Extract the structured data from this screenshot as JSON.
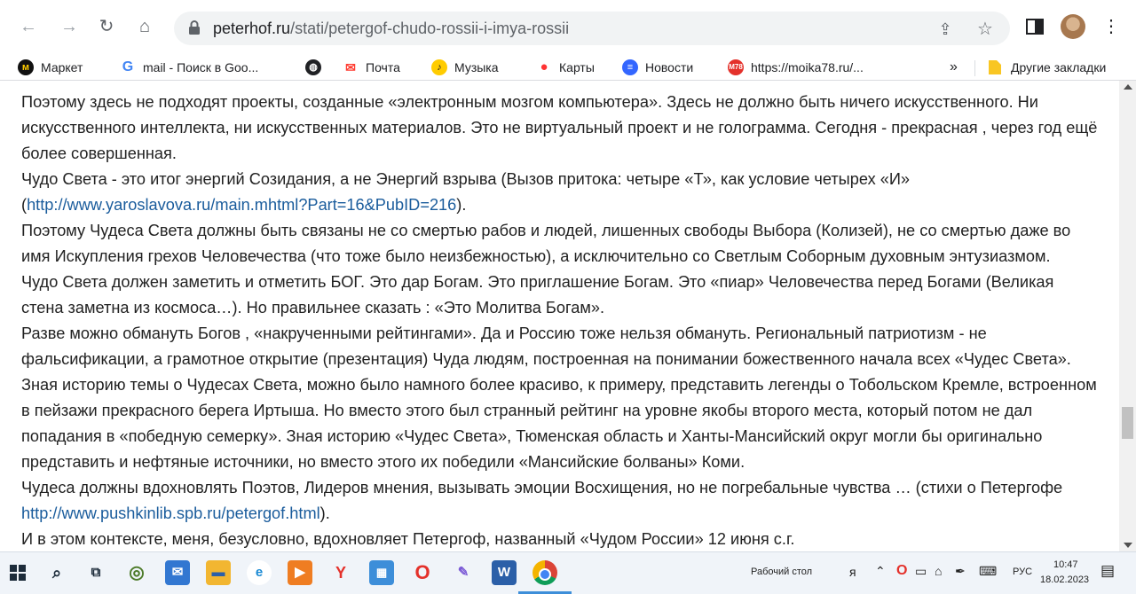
{
  "browser": {
    "url_domain": "peterhof.ru",
    "url_path": "/stati/petergof-chudo-rossii-i-imya-rossii"
  },
  "bookmarks": [
    {
      "label": "Маркет",
      "icon": "yandex-market-icon",
      "color": "#fc3f1d"
    },
    {
      "label": "mail - Поиск в Goo...",
      "icon": "google-icon",
      "color": "#4285f4"
    },
    {
      "label": "",
      "icon": "globe-icon",
      "color": "#202124"
    },
    {
      "label": "Почта",
      "icon": "mail-icon",
      "color": "#ffcc00"
    },
    {
      "label": "Музыка",
      "icon": "music-icon",
      "color": "#ff9900"
    },
    {
      "label": "Карты",
      "icon": "map-pin-icon",
      "color": "#ff3333"
    },
    {
      "label": "Новости",
      "icon": "news-icon",
      "color": "#3366ff"
    },
    {
      "label": "https://moika78.ru/...",
      "icon": "m78-icon",
      "color": "#e4312b"
    }
  ],
  "bookmarks_more": "»",
  "other_bookmarks": "Другие закладки",
  "article": {
    "p1": "Поэтому здесь не подходят проекты, созданные «электронным мозгом компьютера». Здесь не должно быть ничего искусственного. Ни искусственного интеллекта, ни искусственных материалов. Это не виртуальный проект и не голограмма. Сегодня - прекрасная , через год ещё более совершенная.",
    "p2_text": "Чудо Света - это итог энергий Созидания, а не Энергий взрыва (Вызов притока: четыре «Т», как условие четырех «И» (",
    "p2_link": "http://www.yaroslavova.ru/main.mhtml?Part=16&PubID=216",
    "p2_end": ").",
    "p3": "Поэтому Чудеса Света должны быть связаны не со смертью рабов и людей, лишенных свободы Выбора (Колизей), не со смертью даже во имя Искупления грехов Человечества (что тоже было неизбежностью), а исключительно со Светлым Соборным духовным энтузиазмом.",
    "p4": "Чудо Света должен заметить и отметить БОГ. Это дар Богам. Это приглашение Богам. Это «пиар» Человечества перед Богами (Великая стена заметна из космоса…). Но правильнее сказать : «Это Молитва Богам».",
    "p5": "Разве можно обмануть Богов , «накрученными рейтингами». Да и Россию тоже нельзя обмануть. Региональный патриотизм - не фальсификации, а грамотное открытие (презентация) Чуда людям, построенная на понимании божественного начала всех «Чудес Света». Зная историю темы о Чудесах Света, можно было намного более красиво, к примеру, представить легенды о Тобольском Кремле, встроенном в пейзажи прекрасного берега Иртыша. Но вместо этого был странный рейтинг на уровне якобы второго места, который потом не дал попадания в «победную семерку». Зная историю «Чудес Света», Тюменская область и Ханты-Мансийский округ могли бы оригинально представить и нефтяные источники, но вместо этого их победили «Мансийские болваны» Коми.",
    "p6_text": "Чудеса должны вдохновлять Поэтов, Лидеров мнения, вызывать эмоции Восхищения, но не погребальные чувства … (стихи о Петергофе ",
    "p6_link": "http://www.pushkinlib.spb.ru/petergof.html",
    "p6_end": ").",
    "p7": "И в этом контексте, меня, безусловно, вдохновляет Петергоф, названный «Чудом России» 12 июня с.г."
  },
  "taskbar": {
    "desktop_label": "Рабочий стол",
    "lang": "РУС",
    "time": "10:47",
    "date": "18.02.2023"
  }
}
